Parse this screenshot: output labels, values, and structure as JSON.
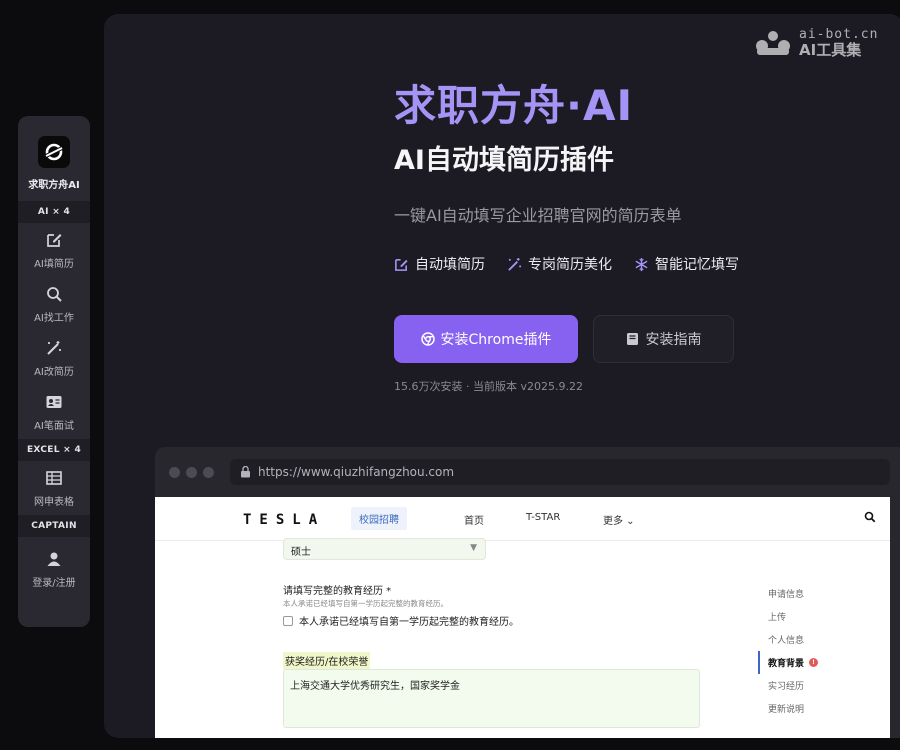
{
  "watermark": {
    "domain": "ai-bot.cn",
    "name": "AI工具集"
  },
  "sidebar": {
    "brand_label": "求职方舟AI",
    "sections": [
      {
        "label": "AI × 4",
        "items": [
          {
            "label": "AI填简历",
            "icon": "edit-icon"
          },
          {
            "label": "AI找工作",
            "icon": "search-icon"
          },
          {
            "label": "AI改简历",
            "icon": "magic-wand-icon"
          },
          {
            "label": "AI笔面试",
            "icon": "id-card-icon"
          }
        ]
      },
      {
        "label": "EXCEL × 4",
        "items": [
          {
            "label": "网申表格",
            "icon": "table-icon"
          }
        ]
      },
      {
        "label": "CAPTAIN",
        "items": [
          {
            "label": "登录/注册",
            "icon": "user-icon"
          }
        ]
      }
    ]
  },
  "hero": {
    "title": "求职方舟·AI",
    "subtitle": "AI自动填简历插件",
    "description": "一键AI自动填写企业招聘官网的简历表单",
    "features": [
      {
        "label": "自动填简历",
        "icon": "edit-icon"
      },
      {
        "label": "专岗简历美化",
        "icon": "magic-wand-icon"
      },
      {
        "label": "智能记忆填写",
        "icon": "snowflake-icon"
      }
    ],
    "primary_button": "安装Chrome插件",
    "secondary_button": "安装指南",
    "install_stats": "15.6万次安装 · 当前版本 v2025.9.22"
  },
  "browser": {
    "url": "https://www.qiuzhifangzhou.com",
    "site": {
      "logo": "TESLA",
      "campus_tab": "校园招聘",
      "nav": [
        "首页",
        "T-STAR",
        "更多"
      ],
      "form": {
        "degree_value": "硕士",
        "edu_label": "请填写完整的教育经历 *",
        "edu_hint": "本人承诺已经填写自第一学历起完整的教育经历。",
        "edu_checkbox": "本人承诺已经填写自第一学历起完整的教育经历。",
        "award_label": "获奖经历/在校荣誉",
        "award_value": "上海交通大学优秀研究生，国家奖学金"
      },
      "toc": [
        {
          "label": "申请信息",
          "active": false
        },
        {
          "label": "上传",
          "active": false
        },
        {
          "label": "个人信息",
          "active": false
        },
        {
          "label": "教育背景",
          "active": true,
          "badge": "!"
        },
        {
          "label": "实习经历",
          "active": false
        },
        {
          "label": "更新说明",
          "active": false
        }
      ]
    }
  },
  "colors": {
    "accent": "#8761f0",
    "title": "#a594f6",
    "panel": "#1c1a23",
    "sidebar": "#2a2931"
  }
}
